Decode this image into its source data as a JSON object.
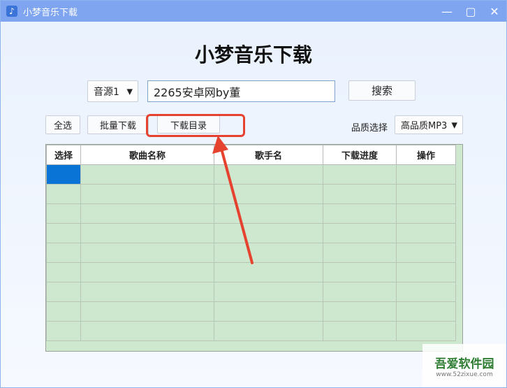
{
  "window": {
    "title": "小梦音乐下载",
    "app_icon": "♪",
    "minimize_glyph": "—",
    "maximize_glyph": "▢",
    "close_glyph": "✕"
  },
  "header": {
    "title": "小梦音乐下载"
  },
  "search": {
    "source_selected": "音源1",
    "query_value": "2265安卓网by董",
    "search_label": "搜索"
  },
  "toolbar": {
    "select_all_label": "全选",
    "batch_download_label": "批量下载",
    "download_dir_label": "下载目录",
    "quality_label": "品质选择",
    "quality_selected": "高品质MP3"
  },
  "table": {
    "columns": [
      "选择",
      "歌曲名称",
      "歌手名",
      "下载进度",
      "操作"
    ]
  },
  "watermark": {
    "main": "吾爱软件园",
    "sub": "www.52zixue.com"
  },
  "colors": {
    "titlebar": "#7fa5f1",
    "table_bg": "#cde8cf",
    "selected_cell": "#0a74d6",
    "annotation": "#e5432f"
  }
}
